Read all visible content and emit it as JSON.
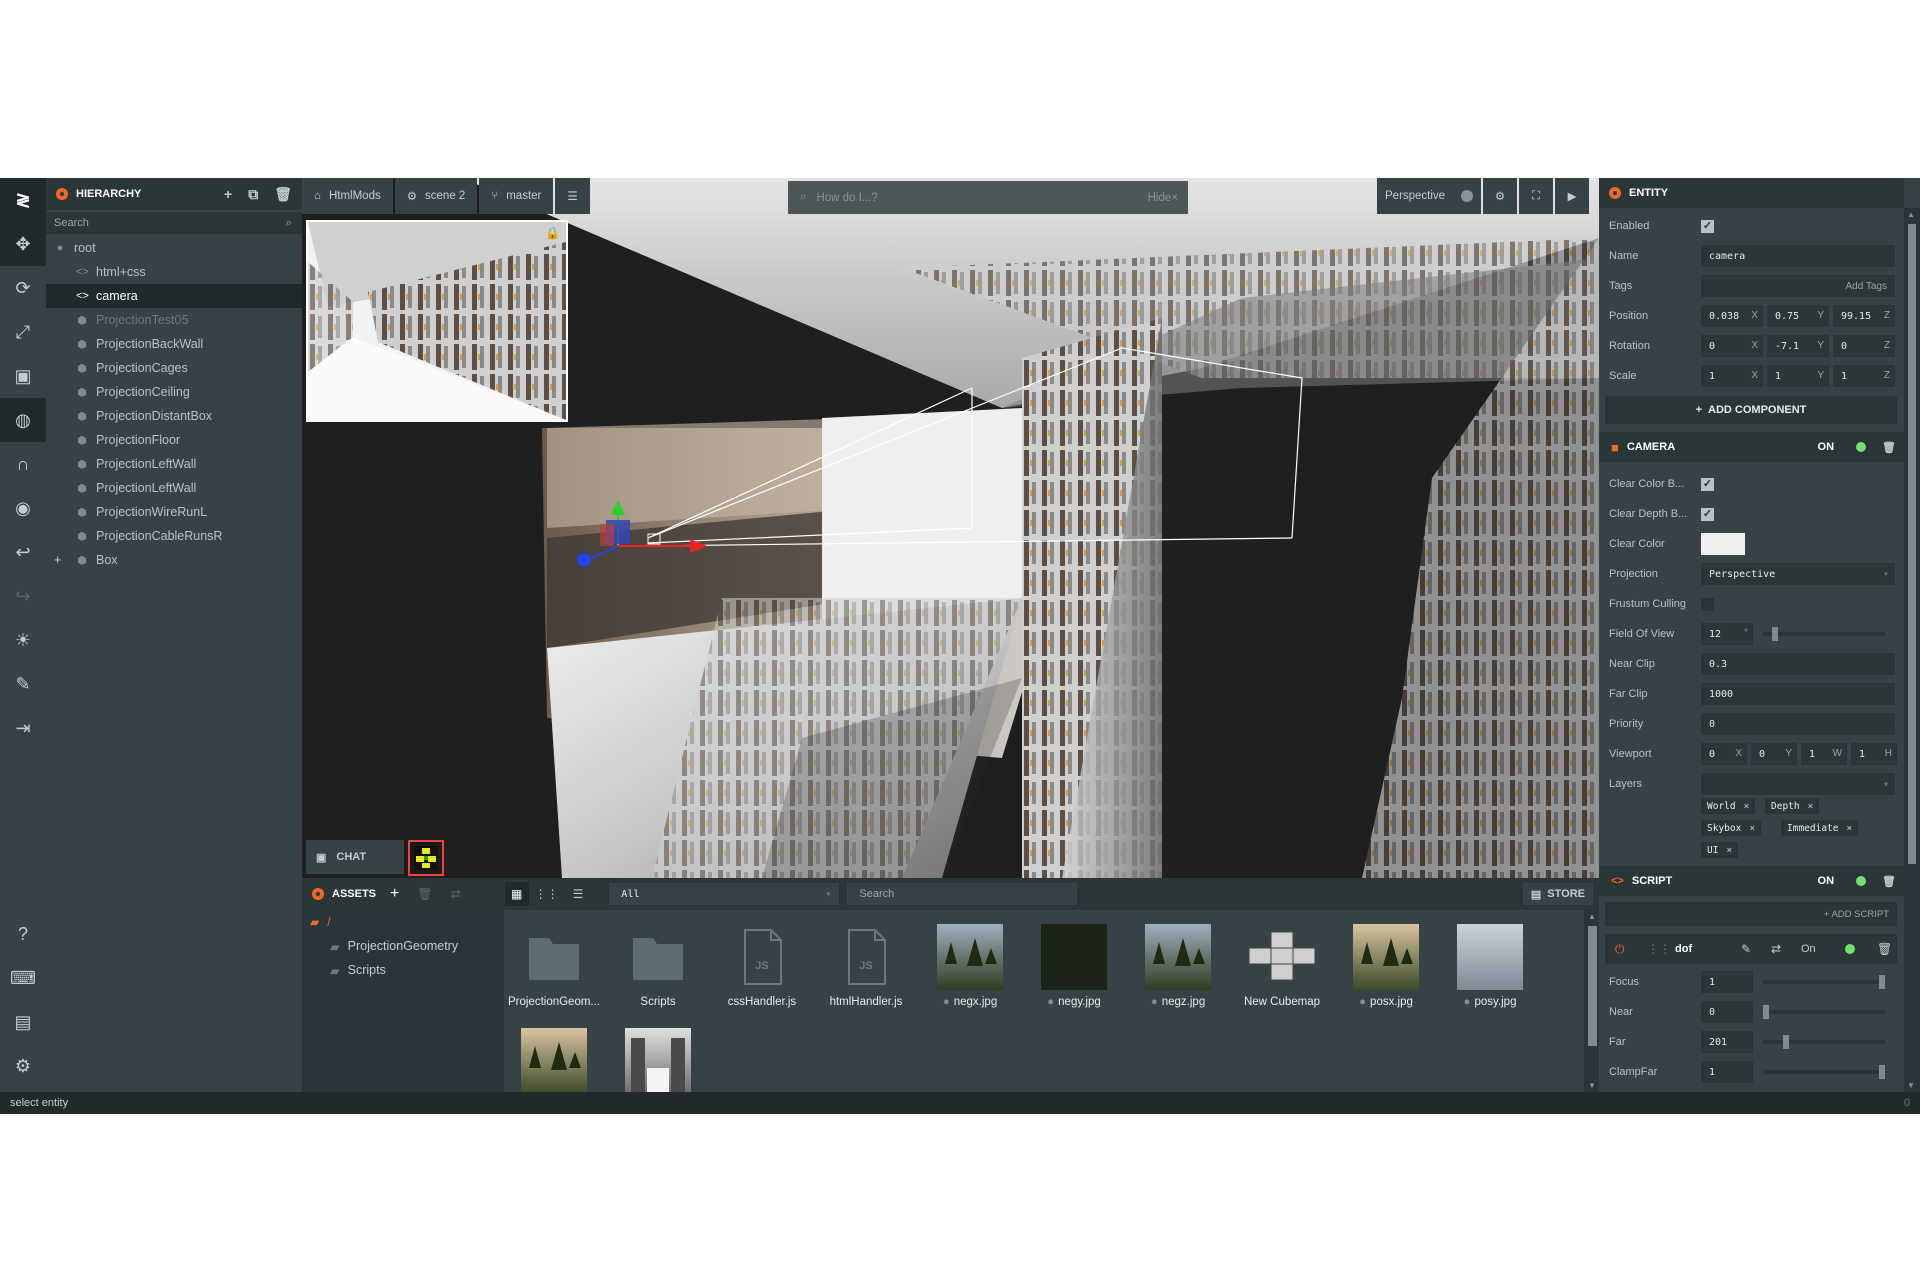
{
  "colors": {
    "accent": "#f26a21",
    "toggle_on": "#6ee46e",
    "panel": "#364346",
    "panel_dark": "#293538"
  },
  "hierarchy": {
    "title": "HIERARCHY",
    "search_placeholder": "Search",
    "items": [
      {
        "label": "root",
        "icon": "circle-icon",
        "indent": 0,
        "selected": false,
        "dim": false
      },
      {
        "label": "html+css",
        "icon": "code-icon",
        "indent": 1,
        "selected": false,
        "dim": false
      },
      {
        "label": "camera",
        "icon": "code-icon",
        "indent": 1,
        "selected": true,
        "dim": false
      },
      {
        "label": "ProjectionTest05",
        "icon": "cube-icon",
        "indent": 1,
        "selected": false,
        "dim": true
      },
      {
        "label": "ProjectionBackWall",
        "icon": "cube-icon",
        "indent": 1,
        "selected": false,
        "dim": false
      },
      {
        "label": "ProjectionCages",
        "icon": "cube-icon",
        "indent": 1,
        "selected": false,
        "dim": false
      },
      {
        "label": "ProjectionCeiling",
        "icon": "cube-icon",
        "indent": 1,
        "selected": false,
        "dim": false
      },
      {
        "label": "ProjectionDistantBox",
        "icon": "cube-icon",
        "indent": 1,
        "selected": false,
        "dim": false
      },
      {
        "label": "ProjectionFloor",
        "icon": "cube-icon",
        "indent": 1,
        "selected": false,
        "dim": false
      },
      {
        "label": "ProjectionLeftWall",
        "icon": "cube-icon",
        "indent": 1,
        "selected": false,
        "dim": false
      },
      {
        "label": "ProjectionLeftWall",
        "icon": "cube-icon",
        "indent": 1,
        "selected": false,
        "dim": false
      },
      {
        "label": "ProjectionWireRunL",
        "icon": "cube-icon",
        "indent": 1,
        "selected": false,
        "dim": false
      },
      {
        "label": "ProjectionCableRunsR",
        "icon": "cube-icon",
        "indent": 1,
        "selected": false,
        "dim": false
      },
      {
        "label": "Box",
        "icon": "cube-icon",
        "indent": 1,
        "selected": false,
        "dim": false,
        "expand": "+"
      }
    ]
  },
  "viewport": {
    "tabs": [
      {
        "label": "HtmlMods",
        "icon": "home-icon"
      },
      {
        "label": "scene 2",
        "icon": "gear-icon"
      },
      {
        "label": "master",
        "icon": "branch-icon"
      }
    ],
    "search_placeholder": "How do I...?",
    "hide_label": "Hide",
    "camera_mode": "Perspective",
    "chat_label": "CHAT"
  },
  "assets": {
    "title": "ASSETS",
    "filter": "All",
    "search_placeholder": "Search",
    "store_label": "STORE",
    "root": "/",
    "folders": [
      "ProjectionGeometry",
      "Scripts"
    ],
    "items": [
      {
        "name": "ProjectionGeom...",
        "kind": "folder"
      },
      {
        "name": "Scripts",
        "kind": "folder"
      },
      {
        "name": "cssHandler.js",
        "kind": "js",
        "badge": "JS"
      },
      {
        "name": "htmlHandler.js",
        "kind": "js",
        "badge": "JS"
      },
      {
        "name": "negx.jpg",
        "kind": "img",
        "tone": "trees"
      },
      {
        "name": "negy.jpg",
        "kind": "img",
        "tone": "dark"
      },
      {
        "name": "negz.jpg",
        "kind": "img",
        "tone": "trees"
      },
      {
        "name": "New Cubemap",
        "kind": "cubemap"
      },
      {
        "name": "posx.jpg",
        "kind": "img",
        "tone": "sunset"
      },
      {
        "name": "posy.jpg",
        "kind": "img",
        "tone": "sky"
      },
      {
        "name": "",
        "kind": "img",
        "tone": "sunset"
      },
      {
        "name": "",
        "kind": "img",
        "tone": "servers"
      }
    ]
  },
  "entity": {
    "title": "ENTITY",
    "enabled_label": "Enabled",
    "name_label": "Name",
    "name_value": "camera",
    "tags_label": "Tags",
    "tags_btn": "Add Tags",
    "position_label": "Position",
    "position": [
      "0.038",
      "0.75",
      "99.15"
    ],
    "rotation_label": "Rotation",
    "rotation": [
      "0",
      "-7.1",
      "0"
    ],
    "scale_label": "Scale",
    "scale": [
      "1",
      "1",
      "1"
    ],
    "axes": [
      "X",
      "Y",
      "Z"
    ],
    "add_component": "ADD COMPONENT"
  },
  "camera": {
    "title": "CAMERA",
    "on_label": "ON",
    "clear_color_buffer": "Clear Color B...",
    "clear_depth_buffer": "Clear Depth B...",
    "clear_color": "Clear Color",
    "projection_label": "Projection",
    "projection_value": "Perspective",
    "frustum_label": "Frustum Culling",
    "fov_label": "Field Of View",
    "fov_value": "12",
    "fov_unit": "°",
    "fov_fraction": 0.08,
    "near_label": "Near Clip",
    "near_value": "0.3",
    "far_label": "Far Clip",
    "far_value": "1000",
    "priority_label": "Priority",
    "priority_value": "0",
    "viewport_label": "Viewport",
    "viewport": [
      "0",
      "0",
      "1",
      "1"
    ],
    "viewport_axes": [
      "X",
      "Y",
      "W",
      "H"
    ],
    "layers_label": "Layers",
    "layers": [
      "World",
      "Depth",
      "Skybox",
      "Immediate",
      "UI"
    ]
  },
  "script": {
    "title": "SCRIPT",
    "on_label": "ON",
    "add_script": "+ ADD SCRIPT",
    "dof_name": "dof",
    "dof_on": "On",
    "attrs": [
      {
        "label": "Focus",
        "value": "1",
        "fraction": 1.0
      },
      {
        "label": "Near",
        "value": "0",
        "fraction": 0.0
      },
      {
        "label": "Far",
        "value": "201",
        "fraction": 0.17
      },
      {
        "label": "ClampFar",
        "value": "1",
        "fraction": 1.0
      }
    ]
  },
  "status": {
    "text": "select entity",
    "right": "0"
  }
}
